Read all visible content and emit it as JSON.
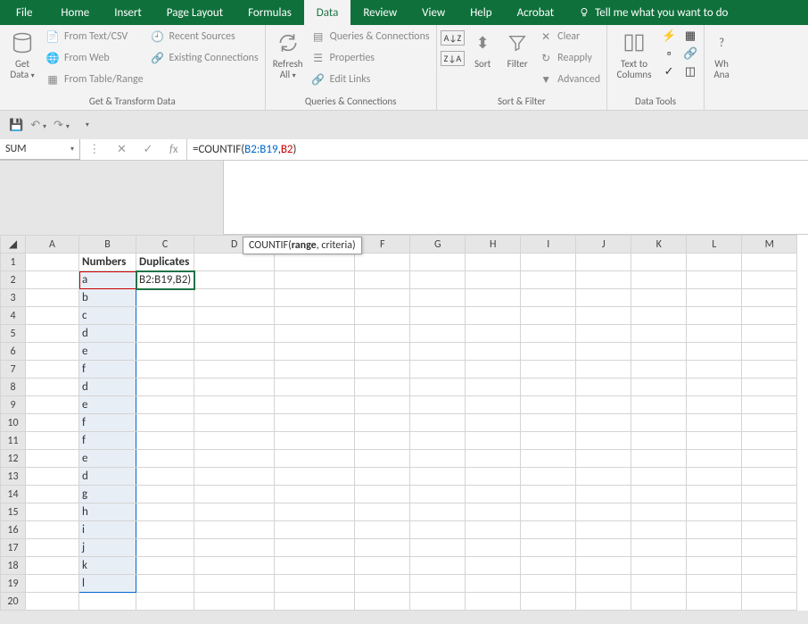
{
  "tabs": {
    "file": "File",
    "home": "Home",
    "insert": "Insert",
    "page_layout": "Page Layout",
    "formulas": "Formulas",
    "data": "Data",
    "review": "Review",
    "view": "View",
    "help": "Help",
    "acrobat": "Acrobat",
    "tell_me": "Tell me what you want to do"
  },
  "ribbon": {
    "get_data": {
      "label": "Get\nData",
      "dropdown": "▾"
    },
    "from_text_csv": "From Text/CSV",
    "from_web": "From Web",
    "from_table": "From Table/Range",
    "recent_sources": "Recent Sources",
    "existing_conn": "Existing Connections",
    "group1_label": "Get & Transform Data",
    "refresh_all": {
      "label": "Refresh\nAll",
      "dropdown": "▾"
    },
    "queries_conn": "Queries & Connections",
    "properties": "Properties",
    "edit_links": "Edit Links",
    "group2_label": "Queries & Connections",
    "sort": "Sort",
    "filter": "Filter",
    "clear": "Clear",
    "reapply": "Reapply",
    "advanced": "Advanced",
    "group3_label": "Sort & Filter",
    "text_to_cols": {
      "label": "Text to\nColumns"
    },
    "group4_label": "Data Tools",
    "what_if": "Wh\nAna"
  },
  "name_box": "SUM",
  "formula": {
    "prefix": "=COUNTIF(",
    "range": "B2:B19",
    "comma": ",",
    "arg2": "B2",
    "suffix": ")"
  },
  "tooltip": {
    "func": "COUNTIF(",
    "bold": "range",
    "rest": ", criteria)"
  },
  "columns": [
    "A",
    "B",
    "C",
    "D",
    "E",
    "F",
    "G",
    "H",
    "I",
    "J",
    "K",
    "L",
    "M"
  ],
  "rows": [
    1,
    2,
    3,
    4,
    5,
    6,
    7,
    8,
    9,
    10,
    11,
    12,
    13,
    14,
    15,
    16,
    17,
    18,
    19,
    20
  ],
  "cells": {
    "B1": "Numbers",
    "C1": "Duplicates",
    "C2": "B2:B19,B2)",
    "B2": "a",
    "B3": "b",
    "B4": "c",
    "B5": "d",
    "B6": "e",
    "B7": "f",
    "B8": "d",
    "B9": "e",
    "B10": "f",
    "B11": "f",
    "B12": "e",
    "B13": "d",
    "B14": "g",
    "B15": "h",
    "B16": "i",
    "B17": "j",
    "B18": "k",
    "B19": "l"
  },
  "chart_data": {
    "type": "table",
    "title": "",
    "columns": [
      "Numbers",
      "Duplicates"
    ],
    "active_formula": "=COUNTIF(B2:B19,B2)",
    "active_cell": "C2",
    "selected_range": "B2:B19",
    "data": [
      {
        "Numbers": "a",
        "Duplicates": "B2:B19,B2)"
      },
      {
        "Numbers": "b",
        "Duplicates": ""
      },
      {
        "Numbers": "c",
        "Duplicates": ""
      },
      {
        "Numbers": "d",
        "Duplicates": ""
      },
      {
        "Numbers": "e",
        "Duplicates": ""
      },
      {
        "Numbers": "f",
        "Duplicates": ""
      },
      {
        "Numbers": "d",
        "Duplicates": ""
      },
      {
        "Numbers": "e",
        "Duplicates": ""
      },
      {
        "Numbers": "f",
        "Duplicates": ""
      },
      {
        "Numbers": "f",
        "Duplicates": ""
      },
      {
        "Numbers": "e",
        "Duplicates": ""
      },
      {
        "Numbers": "d",
        "Duplicates": ""
      },
      {
        "Numbers": "g",
        "Duplicates": ""
      },
      {
        "Numbers": "h",
        "Duplicates": ""
      },
      {
        "Numbers": "i",
        "Duplicates": ""
      },
      {
        "Numbers": "j",
        "Duplicates": ""
      },
      {
        "Numbers": "k",
        "Duplicates": ""
      },
      {
        "Numbers": "l",
        "Duplicates": ""
      }
    ]
  }
}
